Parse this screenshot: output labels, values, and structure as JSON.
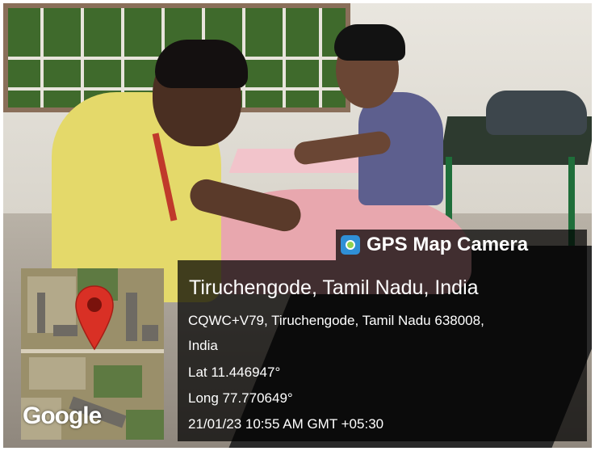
{
  "badge": {
    "app_name": "GPS Map Camera",
    "icon": "camera-lens-icon"
  },
  "location": {
    "title": "Tiruchengode, Tamil Nadu, India",
    "address_line1": "CQWC+V79, Tiruchengode, Tamil Nadu 638008,",
    "address_line2": "India",
    "latitude": "Lat 11.446947°",
    "longitude": "Long 77.770649°",
    "timestamp": "21/01/23 10:55 AM GMT +05:30"
  },
  "map": {
    "provider": "Google",
    "marker_icon": "map-pin-icon",
    "marker_color": "#d93025"
  }
}
